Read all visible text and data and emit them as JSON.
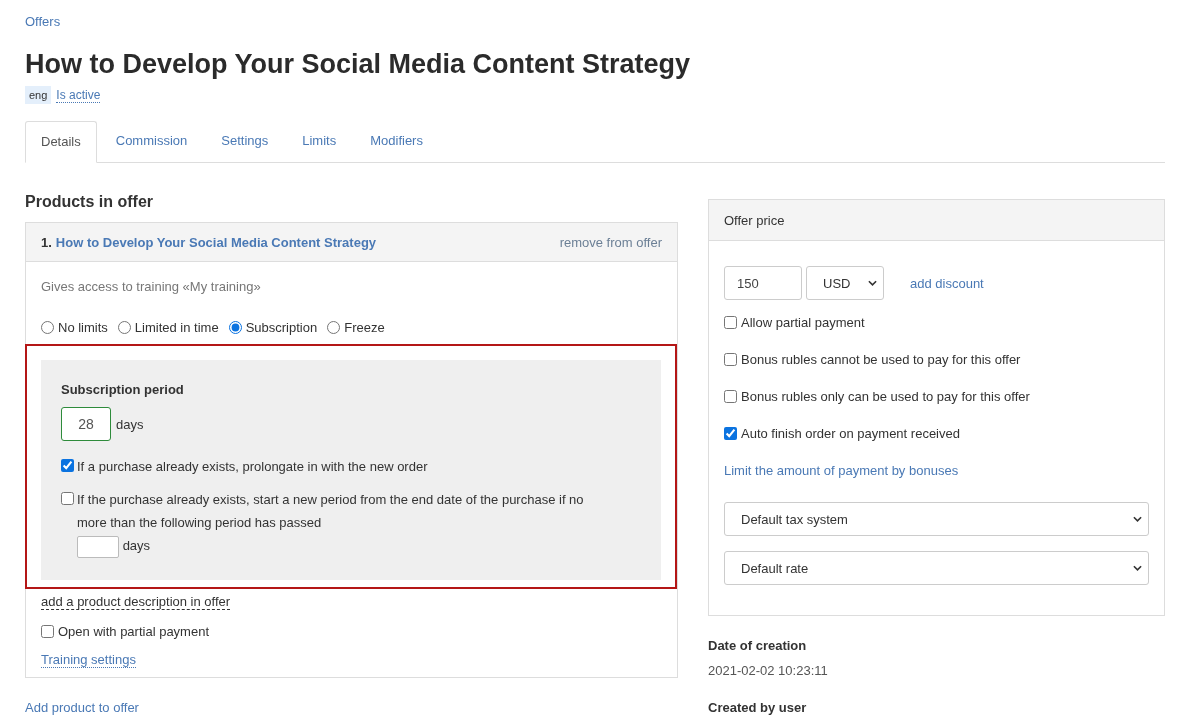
{
  "breadcrumb": "Offers",
  "title": "How to Develop Your Social Media Content Strategy",
  "language_badge": "eng",
  "status_link": "Is active",
  "tabs": [
    {
      "label": "Details",
      "selected": true
    },
    {
      "label": "Commission",
      "selected": false
    },
    {
      "label": "Settings",
      "selected": false
    },
    {
      "label": "Limits",
      "selected": false
    },
    {
      "label": "Modifiers",
      "selected": false
    }
  ],
  "products_heading": "Products in offer",
  "product": {
    "number": "1.",
    "name": "How to Develop Your Social Media Content Strategy",
    "remove_link": "remove from offer",
    "access_text": "Gives access to training «My training»",
    "access_options": [
      {
        "label": "No limits",
        "selected": false
      },
      {
        "label": "Limited in time",
        "selected": false
      },
      {
        "label": "Subscription",
        "selected": true
      },
      {
        "label": "Freeze",
        "selected": false
      }
    ],
    "subscription": {
      "heading": "Subscription period",
      "period_value": "28",
      "period_unit": "days",
      "options": [
        {
          "kind": "plain",
          "label": "If a purchase already exists, prolongate in with the new order",
          "checked": true
        },
        {
          "kind": "with_field",
          "label": "If the purchase already exists, start a new period from the end date of the purchase if no more than the following period has passed",
          "unit": "days",
          "checked": false
        }
      ]
    },
    "description_link": "add a product description in offer",
    "partial_open": {
      "label": "Open with partial payment",
      "checked": false
    },
    "settings_link": "Training settings"
  },
  "add_product_link": "Add product to offer",
  "price_panel": {
    "title": "Offer price",
    "amount": "150",
    "currency": "USD",
    "discount_link": "add discount",
    "options": [
      {
        "label": "Allow partial payment",
        "checked": false
      },
      {
        "label": "Bonus rubles cannot be used to pay for this offer",
        "checked": false
      },
      {
        "label": "Bonus rubles only can be used to pay for this offer",
        "checked": false
      },
      {
        "label": "Auto finish order on payment received",
        "checked": true
      }
    ],
    "bonus_limit_link": "Limit the amount of payment by bonuses",
    "tax_select": "Default tax system",
    "rate_select": "Default rate"
  },
  "meta": [
    {
      "label": "Date of creation",
      "value": "2021-02-02 10:23:11"
    },
    {
      "label": "Created by user"
    }
  ]
}
